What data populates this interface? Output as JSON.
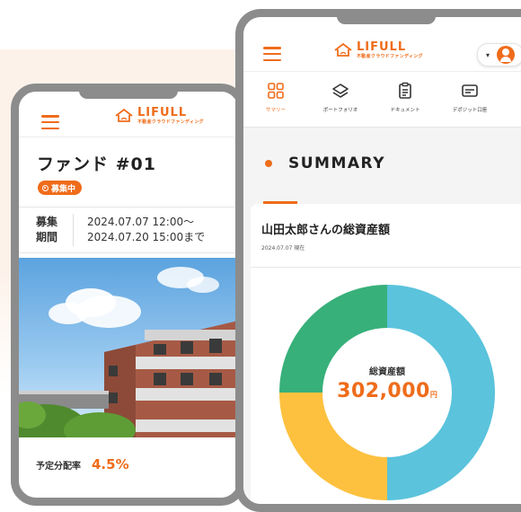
{
  "brand": {
    "name": "LIFULL",
    "tagline": "不動産クラウドファンディング",
    "accent": "#ef6c1a"
  },
  "left_screen": {
    "fund_title": "ファンド #01",
    "status_badge": "募集中",
    "period_label_line1": "募集",
    "period_label_line2": "期間",
    "period_start": "2024.07.07 12:00〜",
    "period_end": "2024.07.20 15:00まで",
    "rate_label": "予定分配率",
    "rate_value": "4.5%"
  },
  "right_screen": {
    "tabs": [
      {
        "label": "サマリー",
        "icon": "grid-icon",
        "active": true
      },
      {
        "label": "ポートフォリオ",
        "icon": "layers-icon",
        "active": false
      },
      {
        "label": "ドキュメント",
        "icon": "document-icon",
        "active": false
      },
      {
        "label": "デポジット口座",
        "icon": "wallet-icon",
        "active": false
      }
    ],
    "section_title": "SUMMARY",
    "card_title": "山田太郎さんの総資産額",
    "card_date": "2024.07.07 現在",
    "total_label": "総資産額",
    "total_value": "302,000",
    "total_unit": "円"
  },
  "chart_data": {
    "type": "pie",
    "series": [
      {
        "value": 0.5,
        "color": "#5bc3dc"
      },
      {
        "value": 0.25,
        "color": "#fdc13f"
      },
      {
        "value": 0.25,
        "color": "#37b07a"
      }
    ]
  }
}
